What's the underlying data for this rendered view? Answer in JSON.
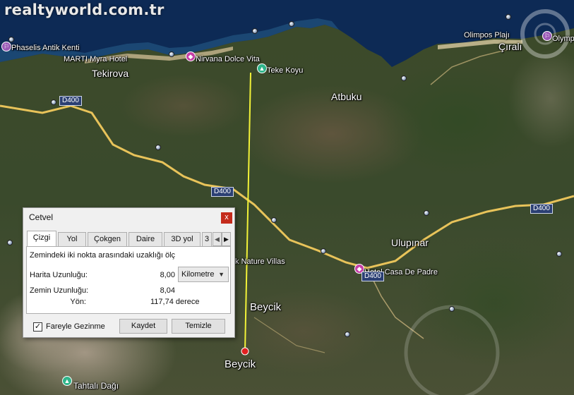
{
  "watermark": "realtyworld.com.tr",
  "places": {
    "tekirova": "Tekirova",
    "atbuku": "Atbuku",
    "ulupinar": "Ulupınar",
    "beycik_upper": "Beycik",
    "beycik_lower": "Beycik",
    "cirali": "Çıralı",
    "olimpos_plaji": "Olimpos Plajı",
    "olympos": "Olymp",
    "phaselis": "Phaselis Antik Kenti",
    "marti_myra": "MARTI Myra Hotel",
    "nirvana": "Nirvana Dolce Vita",
    "teke_koyu": "Teke Koyu",
    "nature_villas": "ık Nature Villas",
    "hotel_casa": "Hotel Casa De Padre",
    "tahtali": "Tahtalı Dağı"
  },
  "roads": {
    "d400_a": "D400",
    "d400_b": "D400",
    "d400_c": "D400",
    "d400_d": "D400"
  },
  "colors": {
    "ruler_line": "#f2f238",
    "road": "#e8c35a",
    "sea": "#0d2a55"
  },
  "dialog": {
    "title": "Cetvel",
    "close_symbol": "x",
    "tabs": [
      "Çizgi",
      "Yol",
      "Çokgen",
      "Daire",
      "3D yol",
      "3"
    ],
    "tab_prev": "◀",
    "tab_next": "▶",
    "description": "Zemindeki iki nokta arasındaki uzaklığı ölç",
    "map_length_label": "Harita Uzunluğu:",
    "map_length_value": "8,00",
    "unit": "Kilometre",
    "ground_length_label": "Zemin Uzunluğu:",
    "ground_length_value": "8,04",
    "heading_label": "Yön:",
    "heading_value": "117,74 derece",
    "mouse_nav_label": "Fareyle Gezinme",
    "mouse_nav_checked": "✓",
    "save_button": "Kaydet",
    "clear_button": "Temizle"
  }
}
